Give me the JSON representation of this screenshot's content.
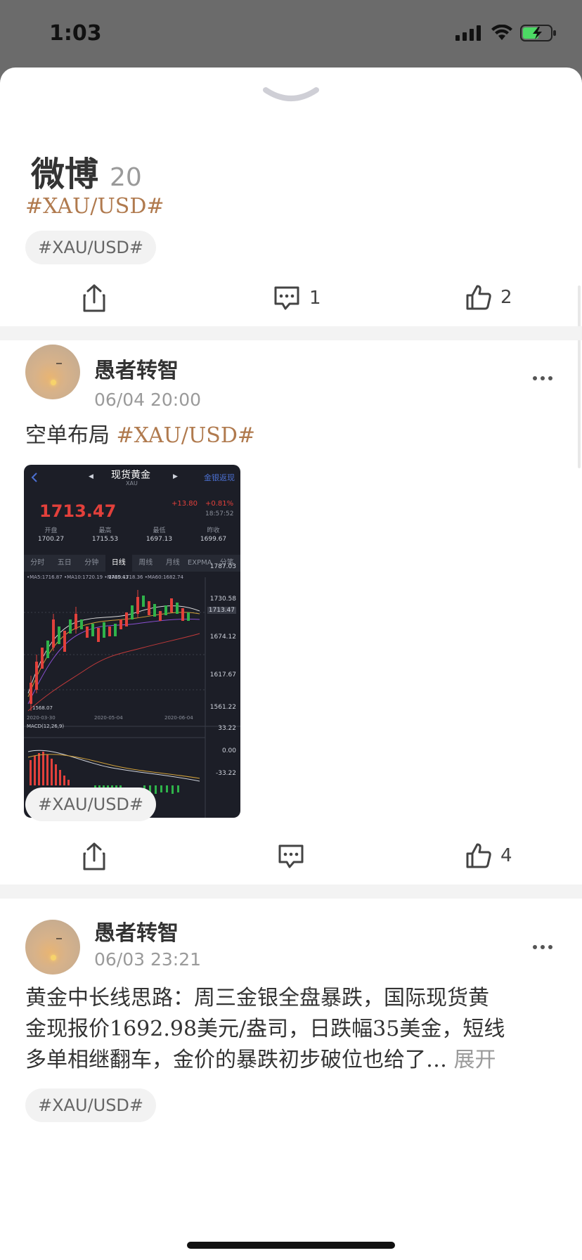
{
  "status": {
    "time": "1:03"
  },
  "sheet": {
    "title": "微博",
    "count": "20"
  },
  "post0": {
    "hashtag": "#XAU/USD#",
    "tag": "#XAU/USD#",
    "comments": "1",
    "likes": "2"
  },
  "post1": {
    "author": "愚者转智",
    "date": "06/04 20:00",
    "text": "空单布局 ",
    "hashtag": "#XAU/USD#",
    "tag": "#XAU/USD#",
    "comments": "",
    "likes": "4",
    "image": {
      "title": "现货黄金",
      "subtitle": "XAU",
      "right_link": "金银返现",
      "price": "1713.47",
      "change": "+13.80",
      "change_pct": "+0.81%",
      "time": "18:57:52",
      "stats": [
        {
          "label": "开盘",
          "value": "1700.27"
        },
        {
          "label": "最高",
          "value": "1715.53"
        },
        {
          "label": "最低",
          "value": "1697.13"
        },
        {
          "label": "昨收",
          "value": "1699.67"
        }
      ],
      "tabs": [
        "分时",
        "五日",
        "分钟",
        "日线",
        "周线",
        "月线",
        "EXPMA",
        "分笔"
      ],
      "ma_line": "•MA5:1716.87  •MA10:1720.19  •MA20:1718.36  •MA60:1682.74",
      "y_labels": [
        "1787.03",
        "1730.58",
        "1713.47",
        "1674.12",
        "1617.67",
        "1561.22"
      ],
      "peak_label": "1765.43",
      "low_label": "1568.07",
      "dates": [
        "2020-03-30",
        "2020-05-04",
        "2020-06-04"
      ],
      "macd_label": "MACD(12,26,9)",
      "macd_y": [
        "33.22",
        "0.00",
        "-33.22"
      ]
    }
  },
  "post2": {
    "author": "愚者转智",
    "date": "06/03 23:21",
    "lines": [
      "黄金中长线思路：周三金银全盘暴跌，国际现货黄",
      "金现报价1692.98美元/盎司，日跌幅35美金，短线",
      "多单相继翻车，金价的暴跌初步破位也给了…"
    ],
    "expand": "展开",
    "tag": "#XAU/USD#"
  }
}
